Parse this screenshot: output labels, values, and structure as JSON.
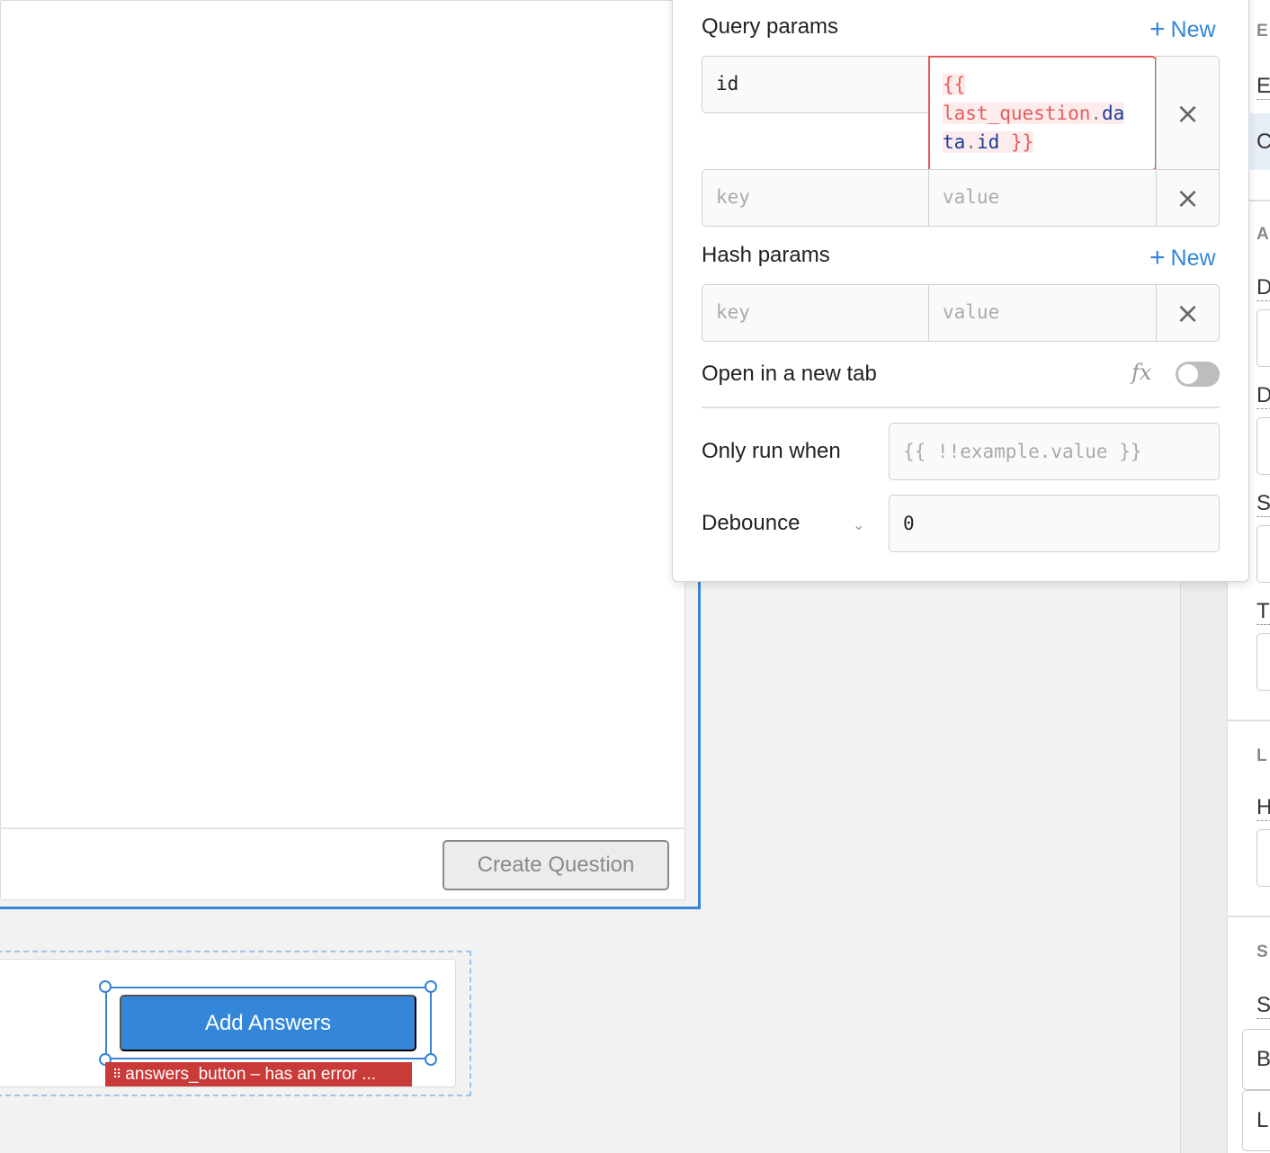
{
  "form": {
    "create_button": "Create Question"
  },
  "lower": {
    "add_button": "Add Answers",
    "error_tag": "answers_button – has an error ..."
  },
  "popover": {
    "query_params": {
      "title": "Query params",
      "new_label": "New",
      "rows": [
        {
          "key": "id",
          "value_parts": [
            "{{",
            "last_question",
            ".",
            "da",
            "ta",
            ".",
            "id",
            "}}"
          ]
        },
        {
          "key_placeholder": "key",
          "value_placeholder": "value"
        }
      ]
    },
    "hash_params": {
      "title": "Hash params",
      "new_label": "New",
      "key_placeholder": "key",
      "value_placeholder": "value"
    },
    "open_new_tab": {
      "label": "Open in a new tab",
      "fx_label": "fx",
      "enabled": false
    },
    "only_run_when": {
      "label": "Only run when",
      "placeholder": "{{ !!example.value }}"
    },
    "debounce": {
      "label": "Debounce",
      "value": "0"
    },
    "delete_icon": "×",
    "plus_icon": "+"
  },
  "inspector": {
    "letters": [
      "E",
      "E",
      "C",
      "A",
      "D",
      "D",
      "S",
      "T",
      "L",
      "H",
      "S",
      "S",
      "B",
      "L"
    ]
  },
  "colors": {
    "accent": "#3487d8",
    "error": "#c93b38",
    "selection": "#3584d8"
  }
}
